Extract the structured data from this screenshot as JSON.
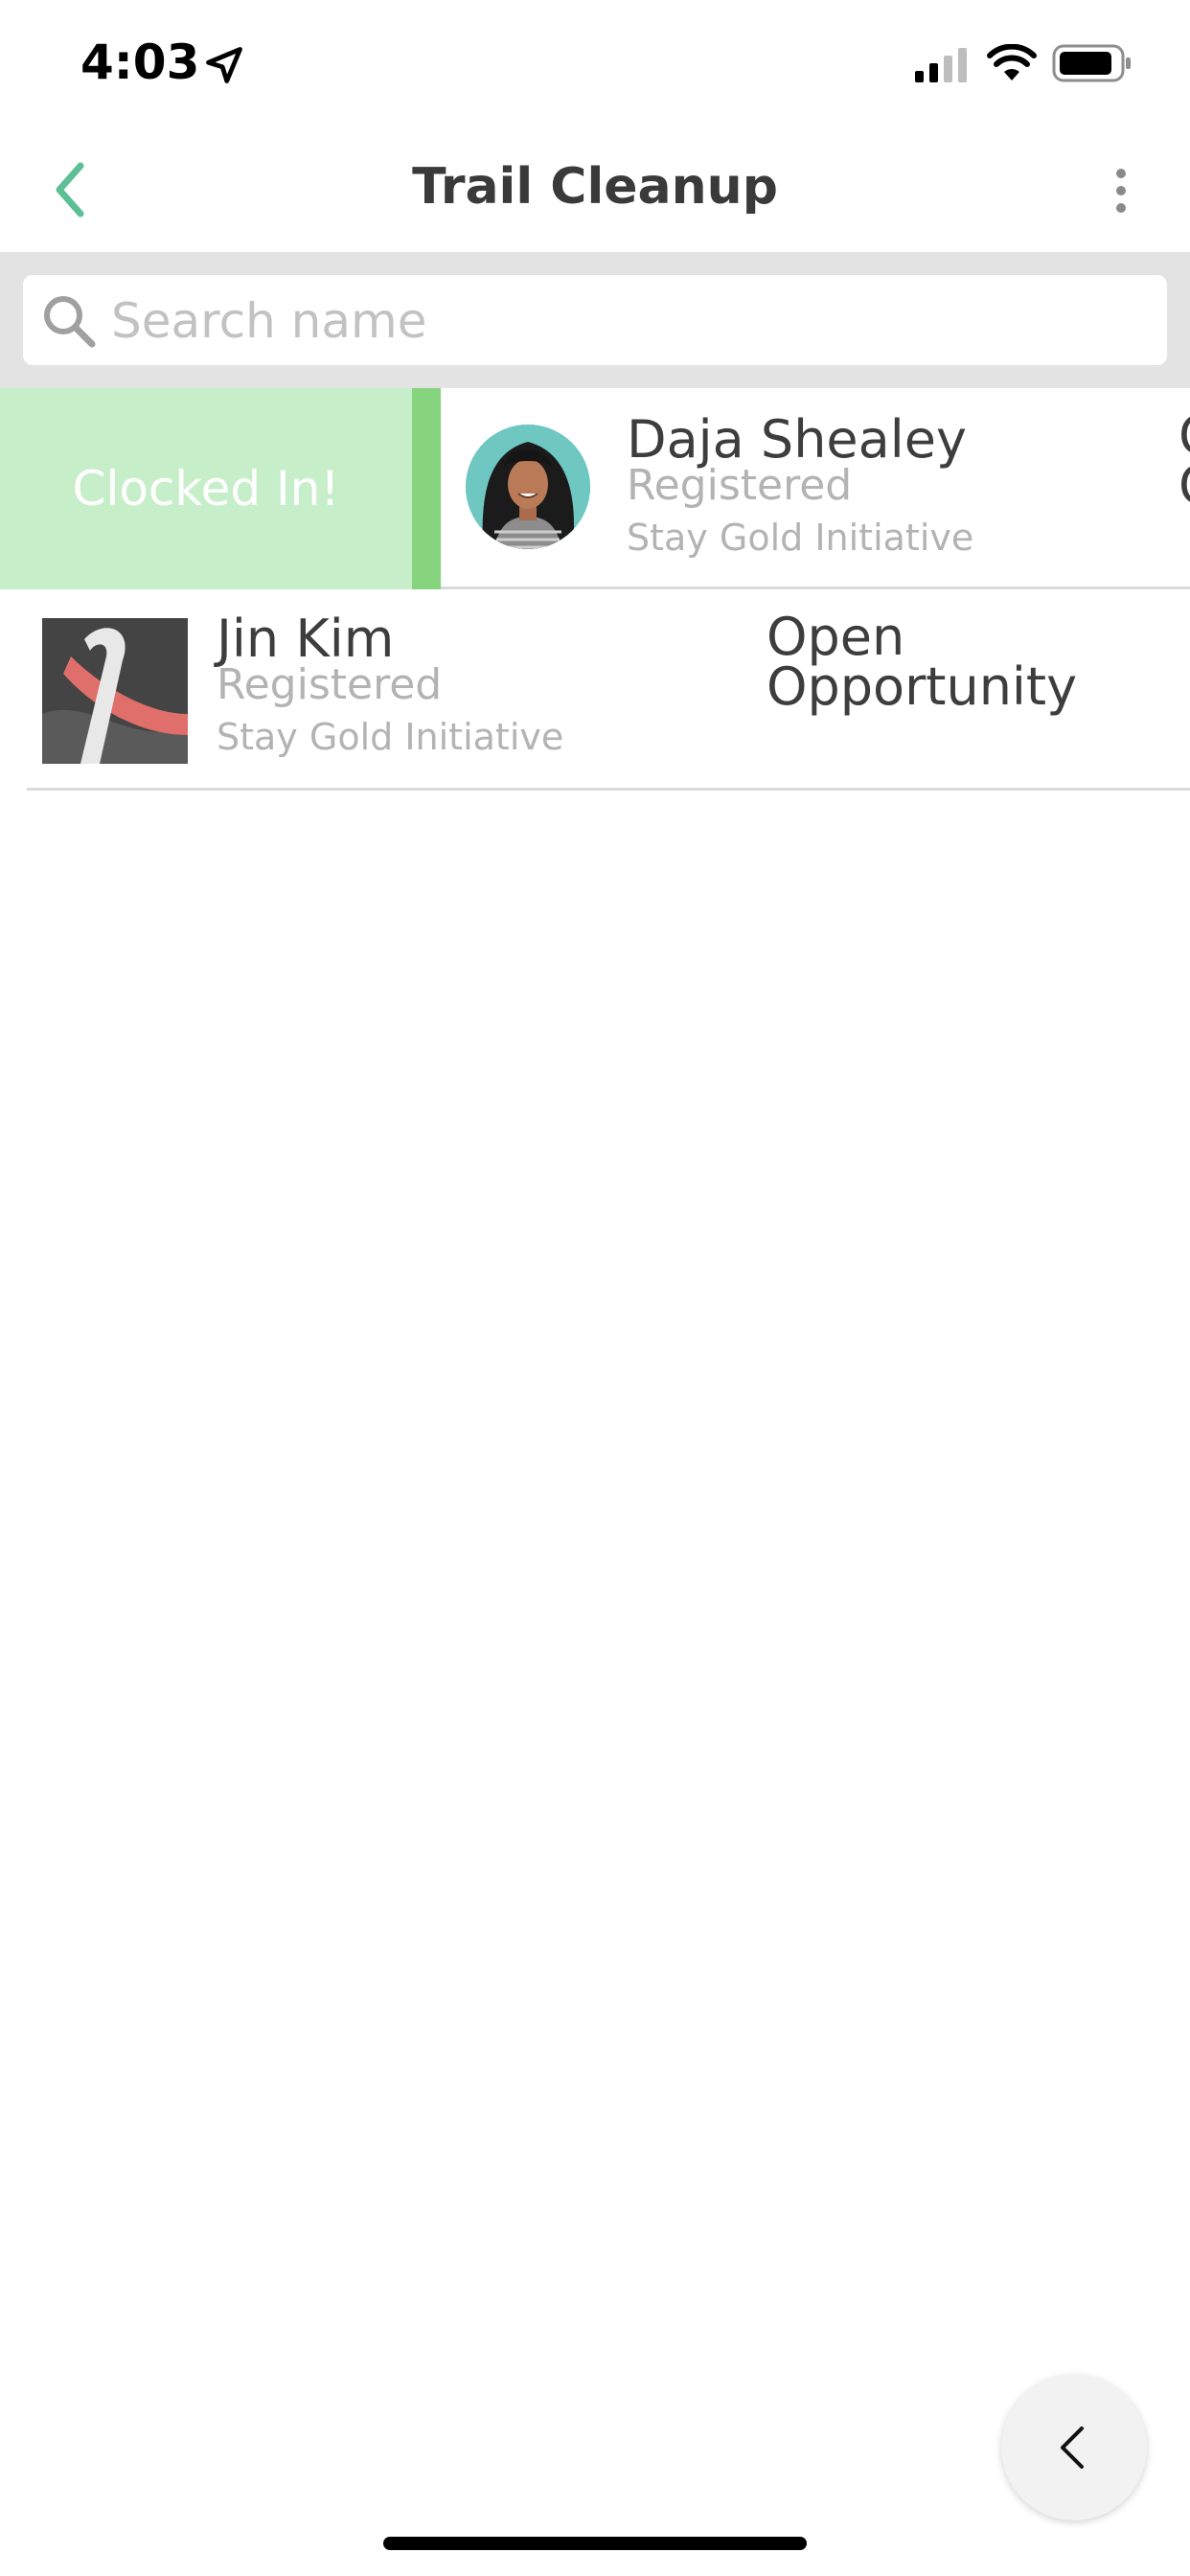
{
  "status_bar": {
    "time": "4:03",
    "icons": [
      "location-arrow-icon",
      "cellular-signal-icon",
      "wifi-icon",
      "battery-icon"
    ]
  },
  "nav": {
    "title": "Trail Cleanup",
    "back_icon": "chevron-left-icon",
    "more_icon": "more-vertical-icon"
  },
  "search": {
    "placeholder": "Search name",
    "value": ""
  },
  "rows": [
    {
      "name": "Daja Shealey",
      "status": "Registered",
      "organization": "Stay Gold Initiative",
      "opportunity": "Open Opportunity",
      "swipe_action_label": "Clocked In!",
      "status_color": "#86d47e",
      "swipe_color": "#c6efc9"
    },
    {
      "name": "Jin Kim",
      "status": "Registered",
      "organization": "Stay Gold Initiative",
      "opportunity": "Open Opportunity"
    }
  ],
  "colors": {
    "accent": "#5cbf95",
    "divider": "#dadada",
    "search_bg": "#e3e3e3"
  },
  "fab": {
    "icon": "chevron-left-icon"
  }
}
